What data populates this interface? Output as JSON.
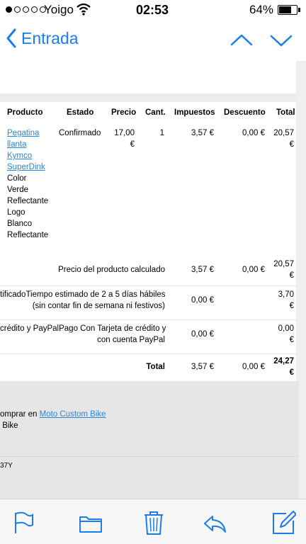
{
  "status_bar": {
    "carrier": "Yoigo",
    "time": "02:53",
    "battery_percent": "64%",
    "battery_level": 0.64
  },
  "nav": {
    "back_label": "Entrada"
  },
  "table": {
    "headers": {
      "producto": "Producto",
      "estado": "Estado",
      "precio": "Precio",
      "cant": "Cant.",
      "impuestos": "Impuestos",
      "descuento": "Descuento",
      "total": "Total"
    },
    "product_links": [
      "Pegatina",
      "llanta",
      "Kymco",
      "SuperDink"
    ],
    "product_details": [
      "Color",
      "Verde",
      "Reflectante",
      "Logo",
      "Blanco",
      "Reflectante"
    ],
    "row1": {
      "estado": "Confirmado",
      "precio_num": "17,00",
      "precio_cur": "€",
      "cant": "1",
      "impuestos": "3,57 €",
      "descuento": "0,00 €",
      "total_num": "20,57",
      "total_cur": "€"
    },
    "calc": {
      "label": "Precio del producto calculado",
      "impuestos": "3,57 €",
      "descuento": "0,00 €",
      "total_num": "20,57",
      "total_cur": "€"
    },
    "shipping": {
      "left_cut": "tificado",
      "line1": "Tiempo estimado de 2 a 5 días hábiles",
      "line2": "(sin contar fin de semana ni festivos)",
      "impuestos": "0,00 €",
      "total_num": "3,70",
      "total_cur": "€"
    },
    "payment": {
      "left_cut": "crédito y PayPal",
      "line1": "Pago Con Tarjeta de crédito y",
      "line2": "con cuenta PayPal",
      "impuestos": "0,00 €",
      "total_num": "0,00",
      "total_cur": "€"
    },
    "grand_total": {
      "label": "Total",
      "impuestos": "3,57 €",
      "descuento": "0,00 €",
      "total_num": "24,27",
      "total_cur": "€"
    }
  },
  "footer": {
    "line1_prefix": "omprar en ",
    "line1_link": "Moto Custom Bike",
    "line2": " Bike",
    "code": "37Y"
  }
}
